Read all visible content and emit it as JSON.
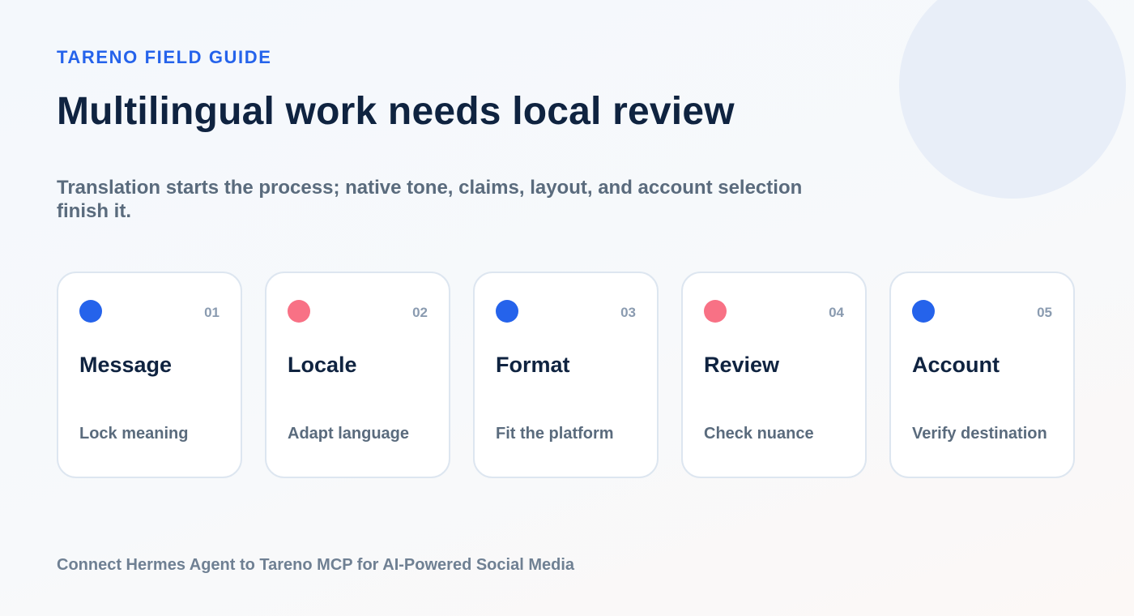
{
  "eyebrow": "TARENO FIELD GUIDE",
  "title": "Multilingual work needs local review",
  "subtitle": "Translation starts the process; native tone, claims, layout, and account selection finish it.",
  "colors": {
    "blue_accent": "#2563eb",
    "pink_accent": "#f87185"
  },
  "cards": [
    {
      "number": "01",
      "title": "Message",
      "desc": "Lock meaning",
      "dot_color": "#2563eb"
    },
    {
      "number": "02",
      "title": "Locale",
      "desc": "Adapt language",
      "dot_color": "#f87185"
    },
    {
      "number": "03",
      "title": "Format",
      "desc": "Fit the platform",
      "dot_color": "#2563eb"
    },
    {
      "number": "04",
      "title": "Review",
      "desc": "Check nuance",
      "dot_color": "#f87185"
    },
    {
      "number": "05",
      "title": "Account",
      "desc": "Verify destination",
      "dot_color": "#2563eb"
    }
  ],
  "footer": "Connect Hermes Agent to Tareno MCP for AI-Powered Social Media"
}
